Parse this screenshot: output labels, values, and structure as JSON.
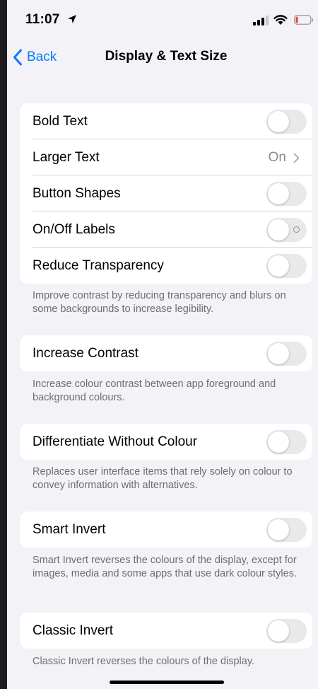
{
  "status_bar": {
    "time": "11:07"
  },
  "nav": {
    "back_label": "Back",
    "title": "Display & Text Size"
  },
  "groups": [
    {
      "rows": [
        {
          "label": "Bold Text",
          "toggle_on": false
        },
        {
          "label": "Larger Text",
          "value": "On"
        },
        {
          "label": "Button Shapes",
          "toggle_on": false
        },
        {
          "label": "On/Off Labels",
          "toggle_on": false
        },
        {
          "label": "Reduce Transparency",
          "toggle_on": false
        }
      ],
      "footer": "Improve contrast by reducing transparency and blurs on some backgrounds to increase legibility."
    },
    {
      "rows": [
        {
          "label": "Increase Contrast",
          "toggle_on": false
        }
      ],
      "footer": "Increase colour contrast between app foreground and background colours."
    },
    {
      "rows": [
        {
          "label": "Differentiate Without Colour",
          "toggle_on": false
        }
      ],
      "footer": "Replaces user interface items that rely solely on colour to convey information with alternatives."
    },
    {
      "rows": [
        {
          "label": "Smart Invert",
          "toggle_on": false
        }
      ],
      "footer": "Smart Invert reverses the colours of the display, except for images, media and some apps that use dark colour styles."
    },
    {
      "rows": [
        {
          "label": "Classic Invert",
          "toggle_on": false
        }
      ],
      "footer": "Classic Invert reverses the colours of the display."
    }
  ],
  "colors": {
    "accent": "#0a7aff",
    "toggle_off": "#e9e9ea",
    "background": "#f2f2f7",
    "battery_low": "#ff3b30"
  },
  "icons": [
    "location-arrow-icon",
    "signal-bars-icon",
    "wifi-icon",
    "battery-icon",
    "chevron-left-icon",
    "chevron-right-icon"
  ]
}
